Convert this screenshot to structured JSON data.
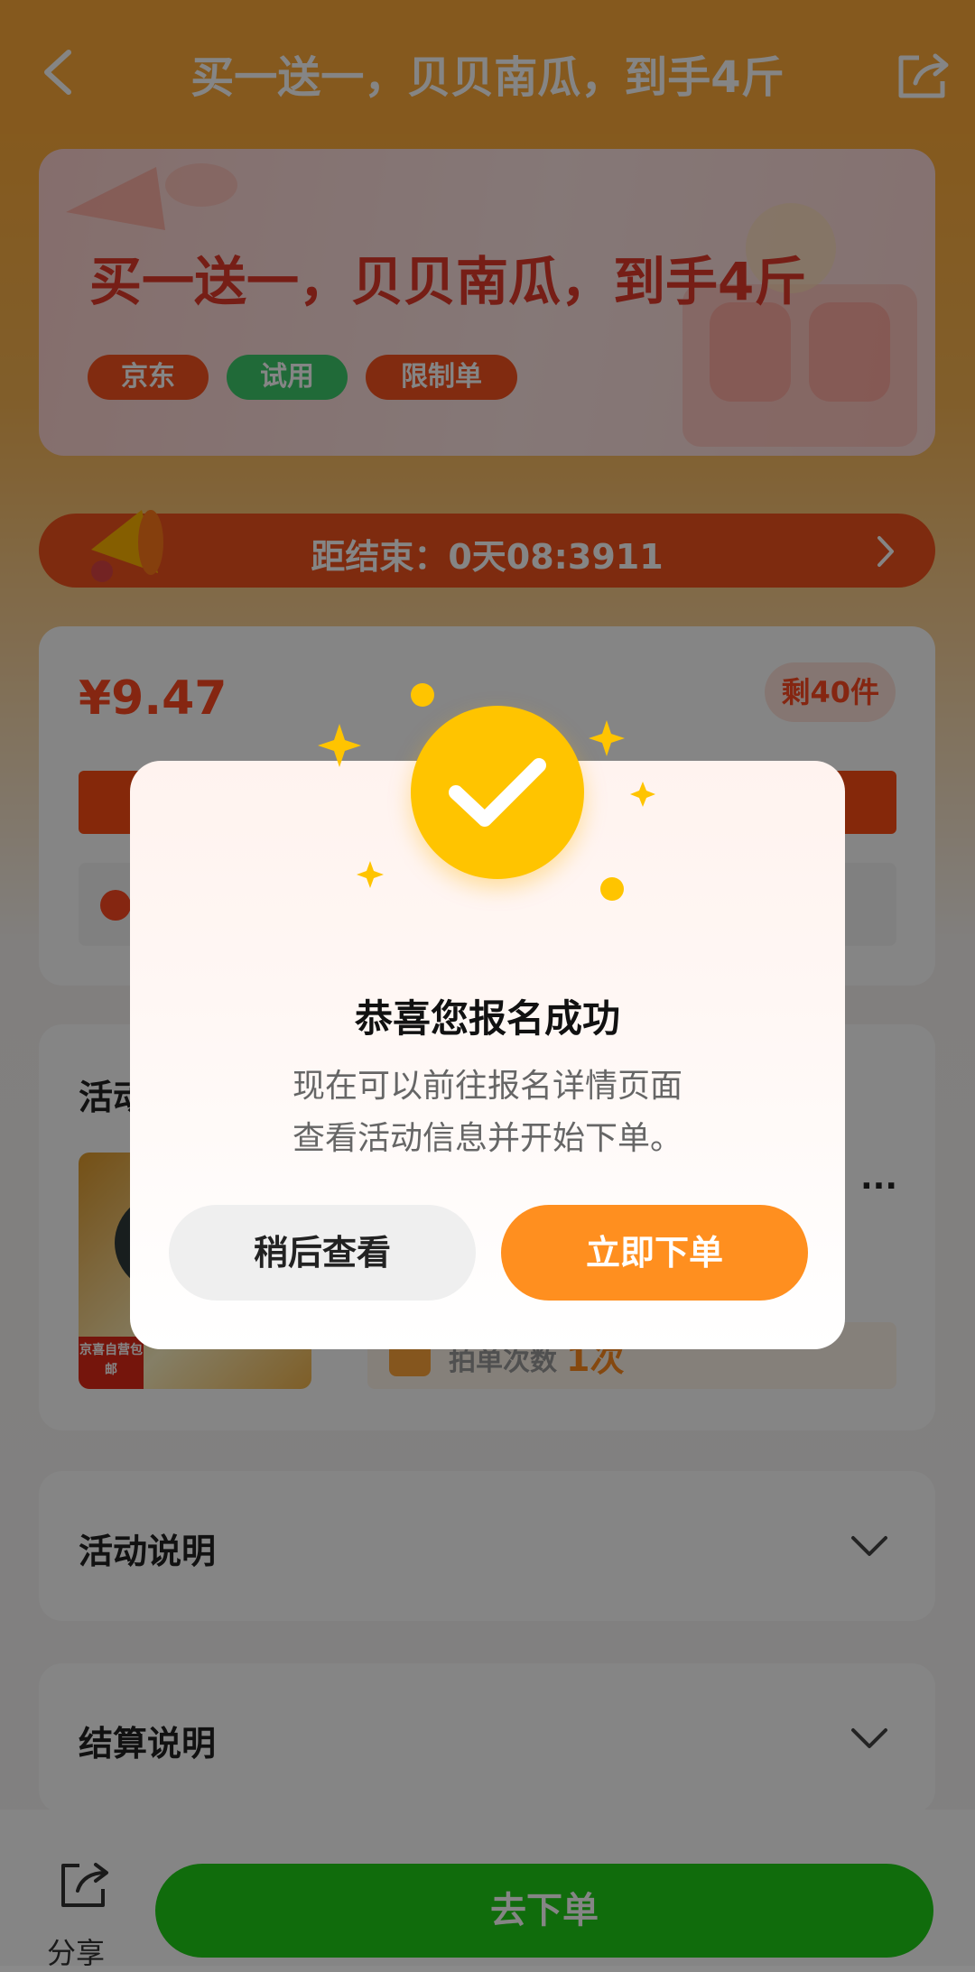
{
  "header": {
    "title": "买一送一，贝贝南瓜，到手4斤",
    "back_icon": "chevron-left-icon",
    "share_icon": "share-icon"
  },
  "banner": {
    "title": "买一送一，贝贝南瓜，到手4斤",
    "tags": [
      "京东",
      "试用",
      "限制单"
    ]
  },
  "countdown": {
    "text": "距结束：0天08:3911"
  },
  "price_card": {
    "price": "¥9.47",
    "remaining": "剩40件"
  },
  "activity": {
    "heading": "活动",
    "product_badge": "京喜自营包邮",
    "product_ellipsis": "...",
    "order_times_label": "拍单次数",
    "order_times_value": "1次"
  },
  "sections": {
    "activity_desc": "活动说明",
    "settlement_desc": "结算说明"
  },
  "bottom_bar": {
    "share_label": "分享",
    "order_button": "去下单"
  },
  "modal": {
    "title": "恭喜您报名成功",
    "message_line1": "现在可以前往报名详情页面",
    "message_line2": "查看活动信息并开始下单。",
    "later_button": "稍后查看",
    "order_now_button": "立即下单"
  },
  "colors": {
    "header_bg": "#ffab3a",
    "accent_orange": "#ff8f1f",
    "order_green": "#1fcf18",
    "check_yellow": "#ffc400"
  }
}
